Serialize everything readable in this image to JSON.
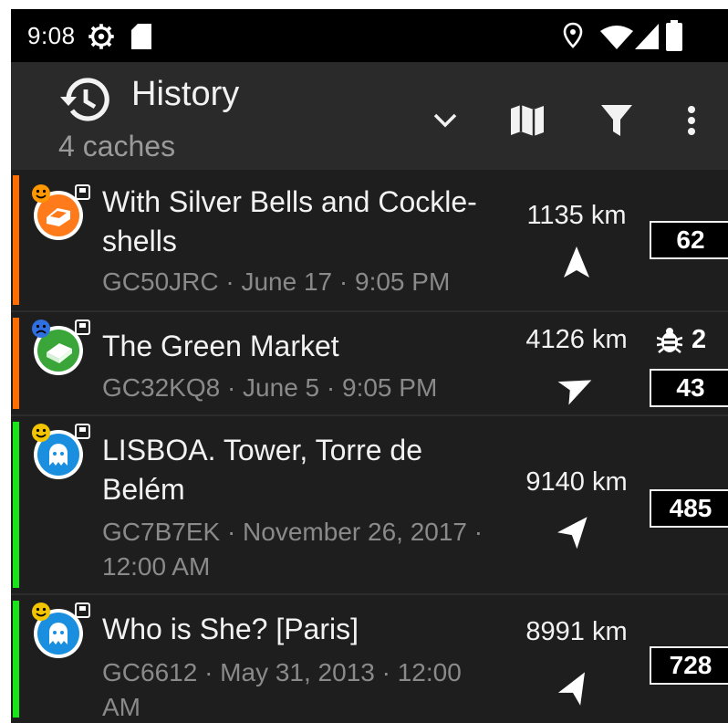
{
  "status_bar": {
    "time": "9:08",
    "icons": [
      "settings-gear-icon",
      "sd-card-icon",
      "location-pin-icon",
      "wifi-icon",
      "signal-icon",
      "battery-icon"
    ]
  },
  "toolbar": {
    "title": "History",
    "subtitle": "4 caches",
    "icons": [
      "history-icon",
      "chevron-down-icon",
      "map-icon",
      "filter-icon",
      "more-vert-icon"
    ]
  },
  "caches": [
    {
      "name": "With Silver Bells and Cockle-shells",
      "info": "GC50JRC · June 17 · 9:05 PM",
      "distance": "1135 km",
      "favorites": "62",
      "stripe_color": "#ff6d00",
      "icon_color": "#ff7a1a",
      "icon_type": "cache-type-icon",
      "rating": "happy-face-icon",
      "rating_color": "#ff9800"
    },
    {
      "name": "The Green Market",
      "info": "GC32KQ8 · June 5 · 9:05 PM",
      "distance": "4126 km",
      "trackables": "2",
      "favorites": "43",
      "stripe_color": "#ff6d00",
      "icon_color": "#3aa63a",
      "icon_type": "traditional-cache-icon",
      "rating": "sad-face-icon",
      "rating_color": "#2f6fe0"
    },
    {
      "name": "LISBOA. Tower, Torre de Belém",
      "info": "GC7B7EK · November 26, 2017 · 12:00 AM",
      "distance": "9140 km",
      "favorites": "485",
      "stripe_color": "#19e619",
      "icon_color": "#1a8fe0",
      "icon_type": "ghost-cache-icon",
      "rating": "happy-face-icon",
      "rating_color": "#f2c500"
    },
    {
      "name": "Who is She? [Paris]",
      "info": "GC6612 · May 31, 2013 · 12:00 AM",
      "distance": "8991 km",
      "favorites": "728",
      "stripe_color": "#19e619",
      "icon_color": "#1a8fe0",
      "icon_type": "ghost-cache-icon",
      "rating": "happy-face-icon",
      "rating_color": "#f2c500"
    }
  ]
}
